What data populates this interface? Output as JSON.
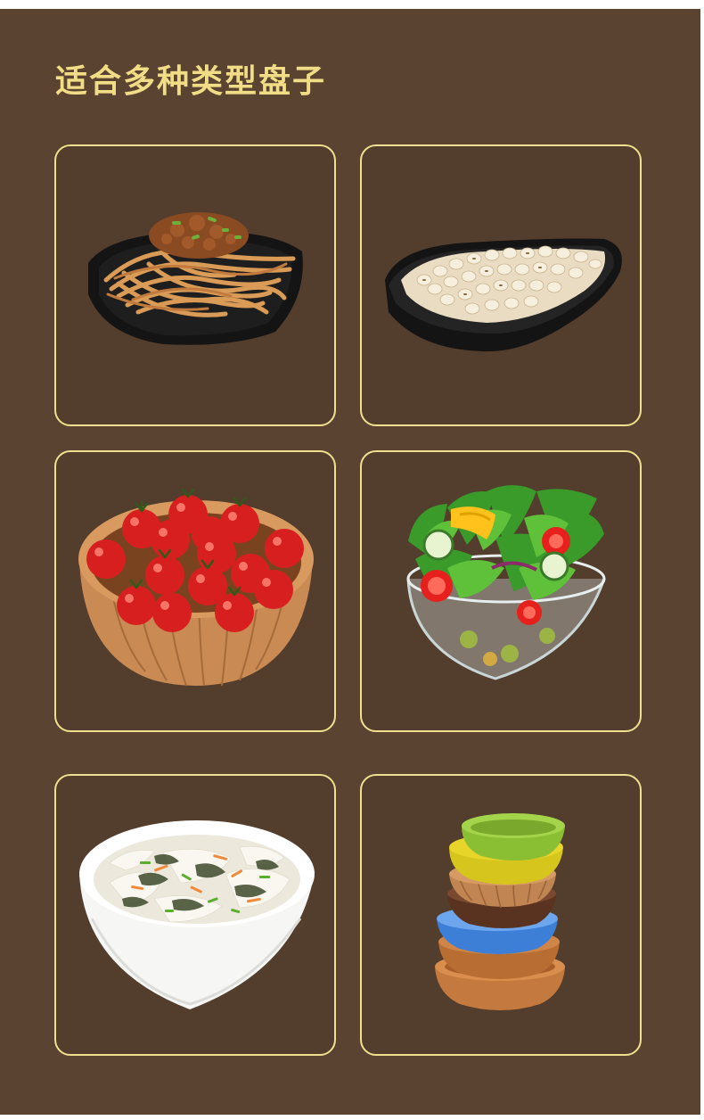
{
  "header": {
    "title": "适合多种类型盘子"
  },
  "cards": [
    {
      "icon": "noodles-plate-icon"
    },
    {
      "icon": "barley-boat-dish-icon"
    },
    {
      "icon": "cherry-tomatoes-wooden-bowl-icon"
    },
    {
      "icon": "salad-glass-bowl-icon"
    },
    {
      "icon": "egg-drop-soup-white-bowl-icon"
    },
    {
      "icon": "stacked-colorful-bowls-icon"
    }
  ],
  "colors": {
    "background": "#5a4330",
    "card_background": "#533d2c",
    "card_border": "#efe08f",
    "title": "#f1dd86"
  }
}
